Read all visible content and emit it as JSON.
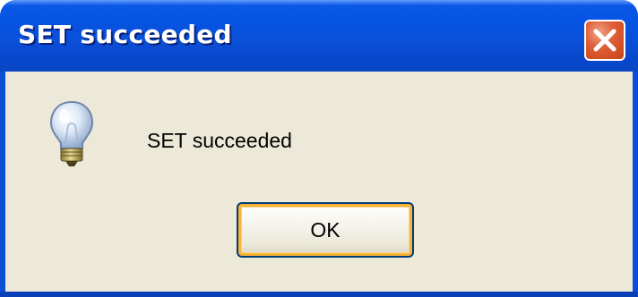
{
  "dialog": {
    "title": "SET succeeded",
    "message": "SET succeeded",
    "icon": "lightbulb-icon",
    "close_icon": "close-icon",
    "ok_label": "OK"
  },
  "colors": {
    "titlebar": "#0a4fd6",
    "client_background": "#ece9d8",
    "close_button": "#e0603a",
    "button_focus": "#f8b334"
  }
}
